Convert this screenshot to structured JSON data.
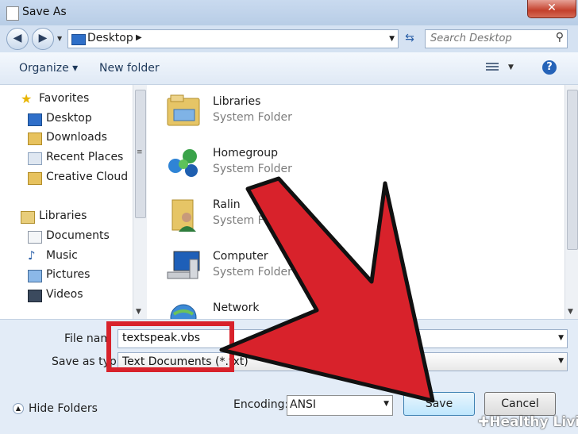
{
  "window": {
    "title": "Save As",
    "close_glyph": "✕"
  },
  "address": {
    "crumb": "Desktop",
    "search_placeholder": "Search Desktop"
  },
  "toolbar": {
    "organize": "Organize ▾",
    "new_folder": "New folder",
    "help": "?"
  },
  "nav": {
    "items": [
      {
        "label": "Favorites",
        "icon": "star-icon"
      },
      {
        "label": "Desktop",
        "icon": "desktop-icon"
      },
      {
        "label": "Downloads",
        "icon": "downloads-icon"
      },
      {
        "label": "Recent Places",
        "icon": "recent-places-icon"
      },
      {
        "label": "Creative Cloud Fil",
        "icon": "creative-cloud-icon"
      },
      {
        "label": "Libraries",
        "icon": "libraries-icon"
      },
      {
        "label": "Documents",
        "icon": "documents-icon"
      },
      {
        "label": "Music",
        "icon": "music-icon"
      },
      {
        "label": "Pictures",
        "icon": "pictures-icon"
      },
      {
        "label": "Videos",
        "icon": "videos-icon"
      }
    ]
  },
  "files": [
    {
      "name": "Libraries",
      "type": "System Folder",
      "icon": "libraries-folder-icon"
    },
    {
      "name": "Homegroup",
      "type": "System Folder",
      "icon": "homegroup-icon"
    },
    {
      "name": "Ralin",
      "type": "System Fo",
      "icon": "user-folder-icon"
    },
    {
      "name": "Computer",
      "type": "System Folder",
      "icon": "computer-icon"
    },
    {
      "name": "Network",
      "type": "",
      "icon": "network-icon"
    }
  ],
  "form": {
    "file_name_label": "File nam",
    "file_name_value": "textspeak.vbs",
    "save_type_label": "Save as typ",
    "save_type_value": "Text Documents (*.txt)",
    "encoding_label": "Encoding:",
    "encoding_value": "ANSI",
    "hide_folders": "Hide Folders",
    "save": "Save",
    "cancel": "Cancel"
  },
  "watermark": "✚Healthy Living",
  "colors": {
    "highlight_red": "#d8222b",
    "arrow_red": "#d8222b",
    "accent_blue": "#2563b8"
  }
}
